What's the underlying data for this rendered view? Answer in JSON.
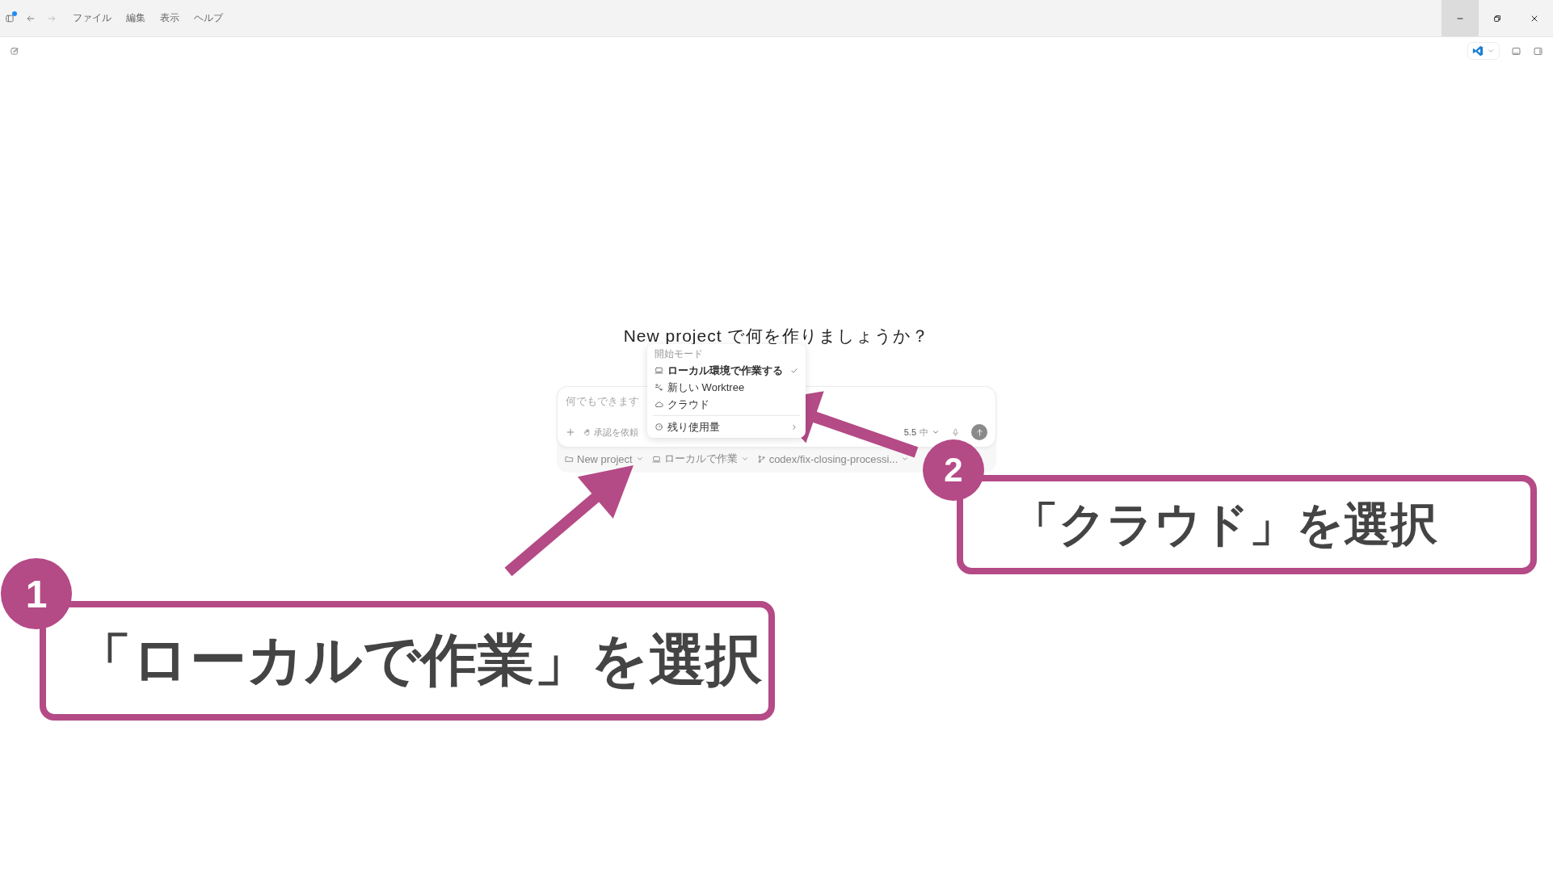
{
  "window": {
    "menu": [
      "ファイル",
      "編集",
      "表示",
      "ヘルプ"
    ]
  },
  "heading": "New project で何を作りましょうか？",
  "composer": {
    "placeholder": "何でもできます",
    "approval": "承認を依頼",
    "model": "5.5",
    "effort": "中"
  },
  "footer": {
    "project": "New project",
    "mode": "ローカルで作業",
    "branch": "codex/fix-closing-processi..."
  },
  "mode_menu": {
    "title": "開始モード",
    "items": [
      {
        "kind": "local",
        "label": "ローカル環境で作業する",
        "selected": true
      },
      {
        "kind": "worktree",
        "label": "新しい Worktree",
        "selected": false
      },
      {
        "kind": "cloud",
        "label": "クラウド",
        "selected": false
      }
    ],
    "usage": "残り使用量"
  },
  "callouts": [
    {
      "number": "1",
      "text": "「ローカルで作業」を選択"
    },
    {
      "number": "2",
      "text": "「クラウド」を選択"
    }
  ]
}
